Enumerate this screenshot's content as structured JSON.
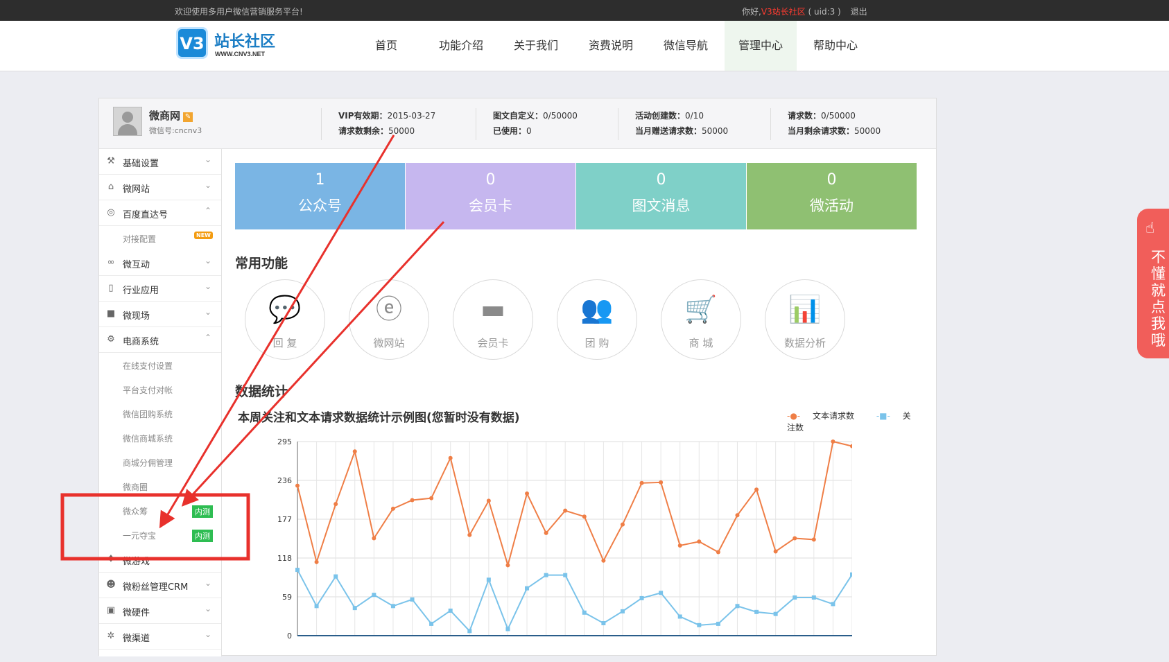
{
  "topbar": {
    "welcome": "欢迎使用多用户微信营销服务平台!",
    "greet_prefix": "你好,",
    "username": "V3站长社区",
    "uid": "( uid:3 )",
    "logout": "退出"
  },
  "logo": {
    "badge": "V3",
    "name": "站长社区",
    "url": "WWW.CNV3.NET"
  },
  "nav": [
    "首页",
    "功能介绍",
    "关于我们",
    "资费说明",
    "微信导航",
    "管理中心",
    "帮助中心"
  ],
  "nav_active": "管理中心",
  "profile": {
    "name": "微商网",
    "wechat": "微信号:cncnv3",
    "vip_label": "VIP有效期：",
    "vip_value": "2015-03-27",
    "remaining_label": "请求数剩余：",
    "remaining_value": "50000",
    "custom_label": "图文自定义：",
    "custom_value": "0/50000",
    "used_label": "已使用：",
    "used_value": "0",
    "activity_label": "活动创建数：",
    "activity_value": "0/10",
    "gift_label": "当月赠送请求数：",
    "gift_value": "50000",
    "requests_label": "请求数：",
    "requests_value": "0/50000",
    "month_left_label": "当月剩余请求数：",
    "month_left_value": "50000"
  },
  "sidebar": {
    "items": [
      {
        "icon": "wrench-icon",
        "glyph": "⚒",
        "label": "基础设置",
        "chev": "⌄"
      },
      {
        "icon": "home-icon",
        "glyph": "⌂",
        "label": "微网站",
        "chev": "⌄"
      },
      {
        "icon": "baidu-icon",
        "glyph": "◎",
        "label": "百度直达号",
        "chev": "⌃"
      },
      {
        "icon": "link-icon",
        "glyph": "∞",
        "label": "微互动",
        "chev": "⌄"
      },
      {
        "icon": "device-icon",
        "glyph": "▯",
        "label": "行业应用",
        "chev": "⌄"
      },
      {
        "icon": "video-icon",
        "glyph": "■",
        "label": "微现场",
        "chev": "⌄"
      },
      {
        "icon": "gear-icon",
        "glyph": "⚙",
        "label": "电商系统",
        "chev": "⌃"
      },
      {
        "icon": "gamepad-icon",
        "glyph": "✥",
        "label": "微游戏",
        "chev": "⌄"
      },
      {
        "icon": "users-icon",
        "glyph": "☻",
        "label": "微粉丝管理CRM",
        "chev": "⌄"
      },
      {
        "icon": "hardware-icon",
        "glyph": "▣",
        "label": "微硬件",
        "chev": "⌄"
      },
      {
        "icon": "channel-icon",
        "glyph": "✲",
        "label": "微渠道",
        "chev": "⌄"
      }
    ],
    "baidu_sub": "对接配置",
    "new_tag": "NEW",
    "ecommerce_subs": [
      "在线支付设置",
      "平台支付对帐",
      "微信团购系统",
      "微信商城系统",
      "商城分佣管理",
      "微商圈",
      "微众筹",
      "一元夺宝"
    ],
    "beta_tag": "内测"
  },
  "tiles": [
    {
      "num": "1",
      "label": "公众号",
      "color": "#7ab5e4"
    },
    {
      "num": "0",
      "label": "会员卡",
      "color": "#c6b7ef"
    },
    {
      "num": "0",
      "label": "图文消息",
      "color": "#7fd0c8"
    },
    {
      "num": "0",
      "label": "微活动",
      "color": "#8fc072"
    }
  ],
  "common_title": "常用功能",
  "functions": [
    {
      "icon": "reply-icon",
      "glyph": "💬",
      "label": "回 复"
    },
    {
      "icon": "website-icon",
      "glyph": "ⓔ",
      "label": "微网站"
    },
    {
      "icon": "card-icon",
      "glyph": "▬",
      "label": "会员卡"
    },
    {
      "icon": "group-buy-icon",
      "glyph": "👥",
      "label": "团 购"
    },
    {
      "icon": "cart-icon",
      "glyph": "🛒",
      "label": "商 城"
    },
    {
      "icon": "bar-chart-icon",
      "glyph": "📊",
      "label": "数据分析"
    }
  ],
  "stats_title": "数据统计",
  "help_tab": {
    "text": "不懂就点我哦"
  },
  "chart_data": {
    "type": "line",
    "title": "本周关注和文本请求数据统计示例图(您暂时没有数据)",
    "xlabel": "",
    "ylabel": "",
    "ylim": [
      0,
      295
    ],
    "yticks": [
      0,
      59,
      118,
      177,
      236,
      295
    ],
    "legend_position": "top-right",
    "x": [
      1,
      2,
      3,
      4,
      5,
      6,
      7,
      8,
      9,
      10,
      11,
      12,
      13,
      14,
      15,
      16,
      17,
      18,
      19,
      20,
      21,
      22,
      23,
      24,
      25,
      26,
      27,
      28,
      29,
      30
    ],
    "series": [
      {
        "name": "文本请求数",
        "color": "#ef7e46",
        "values": [
          228,
          112,
          200,
          280,
          148,
          193,
          206,
          209,
          270,
          153,
          205,
          107,
          216,
          156,
          190,
          181,
          114,
          169,
          232,
          233,
          137,
          143,
          127,
          183,
          222,
          128,
          148,
          146,
          295,
          288
        ]
      },
      {
        "name": "关注数",
        "color": "#7ac3ea",
        "values": [
          100,
          45,
          90,
          42,
          62,
          45,
          55,
          18,
          38,
          7,
          85,
          10,
          72,
          92,
          92,
          35,
          19,
          37,
          57,
          65,
          29,
          16,
          18,
          45,
          36,
          33,
          58,
          58,
          48,
          93
        ]
      }
    ]
  }
}
